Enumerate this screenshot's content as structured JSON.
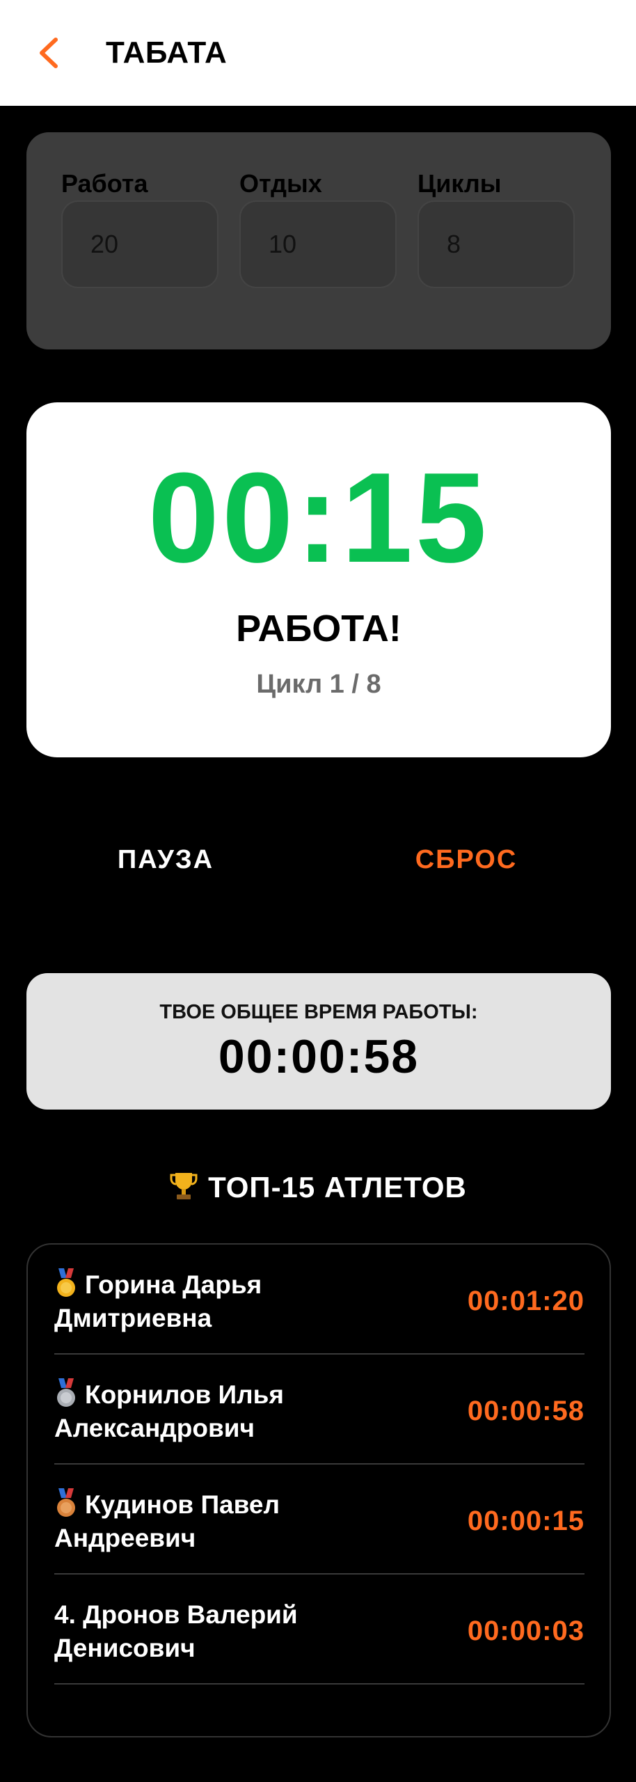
{
  "header": {
    "title": "ТАБАТА",
    "back_icon": "chevron-left-icon"
  },
  "settings": {
    "work": {
      "label": "Работа",
      "value": "20"
    },
    "rest": {
      "label": "Отдых",
      "value": "10"
    },
    "cycles": {
      "label": "Циклы",
      "value": "8"
    }
  },
  "timer": {
    "value": "00:15",
    "phase": "РАБОТА!",
    "cycle": "Цикл 1 / 8"
  },
  "controls": {
    "pause_label": "ПАУЗА",
    "reset_label": "СБРОС"
  },
  "total": {
    "label": "ТВОЕ ОБЩЕЕ ВРЕМЯ РАБОТЫ:",
    "value": "00:00:58"
  },
  "leaderboard": {
    "heading": "ТОП-15 АТЛЕТОВ",
    "rows": [
      {
        "medal": "gold-medal-icon",
        "prefix": "",
        "line1": "Горина Дарья",
        "line2": "Дмитриевна",
        "time": "00:01:20"
      },
      {
        "medal": "silver-medal-icon",
        "prefix": "",
        "line1": "Корнилов Илья",
        "line2": "Александрович",
        "time": "00:00:58"
      },
      {
        "medal": "bronze-medal-icon",
        "prefix": "",
        "line1": "Кудинов Павел",
        "line2": "Андреевич",
        "time": "00:00:15"
      },
      {
        "medal": "",
        "prefix": "4.",
        "line1": "Дронов Валерий",
        "line2": "Денисович",
        "time": "00:00:03"
      }
    ]
  },
  "colors": {
    "accent": "#ff6a1f",
    "timer_green": "#0ac052",
    "gold": "#f2b21c",
    "silver": "#a9adb3",
    "bronze": "#d9823a"
  }
}
